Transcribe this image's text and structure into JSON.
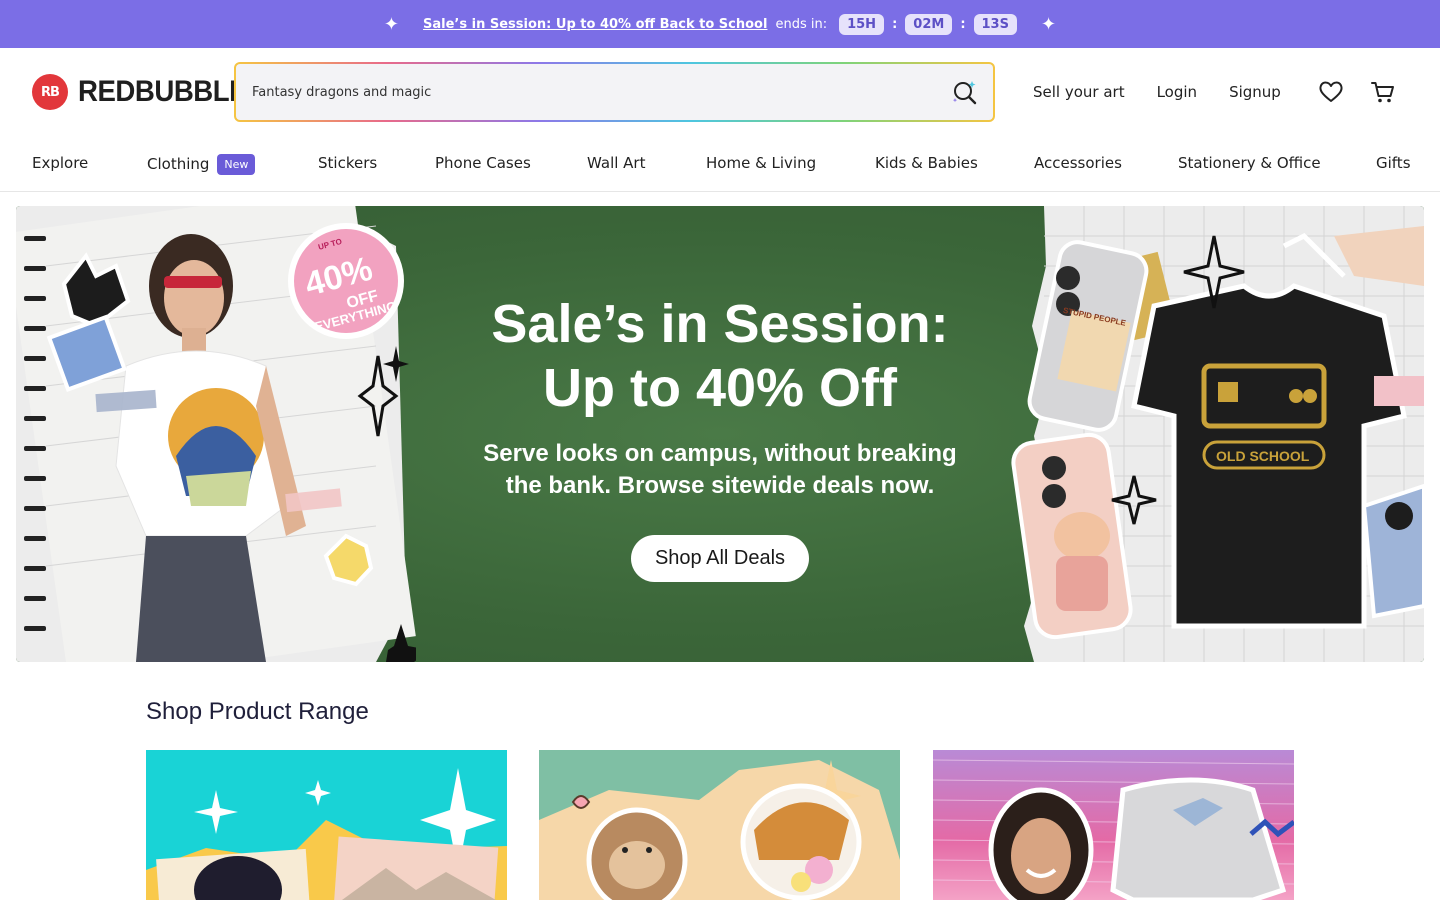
{
  "promo": {
    "link_text": "Sale’s in Session: Up to 40% off Back to School",
    "ends_text": "ends in:",
    "hours": "15H",
    "minutes": "02M",
    "seconds": "13S"
  },
  "header": {
    "logo_mark": "RB",
    "logo_text": "REDBUBBLE",
    "search_value": "Fantasy dragons and magic",
    "sell_label": "Sell your art",
    "login_label": "Login",
    "signup_label": "Signup"
  },
  "categories": {
    "explore": "Explore",
    "clothing": "Clothing",
    "clothing_badge": "New",
    "stickers": "Stickers",
    "phone_cases": "Phone Cases",
    "wall_art": "Wall Art",
    "home_living": "Home & Living",
    "kids_babies": "Kids & Babies",
    "accessories": "Accessories",
    "stationery_office": "Stationery & Office",
    "gifts": "Gifts"
  },
  "hero": {
    "title_line1": "Sale’s in Session:",
    "title_line2": "Up to 40% Off",
    "subtitle_line1": "Serve looks on campus, without breaking",
    "subtitle_line2": "the bank. Browse sitewide deals now.",
    "cta_label": "Shop All Deals",
    "sticker_top": "UP TO",
    "sticker_big": "40%",
    "sticker_off": "OFF",
    "sticker_bottom": "EVERYTHING",
    "shirt_text": "OLD SCHOOL",
    "phone_text": "STUPID PEOPLE"
  },
  "range": {
    "title": "Shop Product Range"
  },
  "colors": {
    "promo_bg": "#7b6ee6",
    "brand_red": "#e2373b",
    "hero_green": "#3f6b3e",
    "badge_purple": "#6a5bd8"
  }
}
